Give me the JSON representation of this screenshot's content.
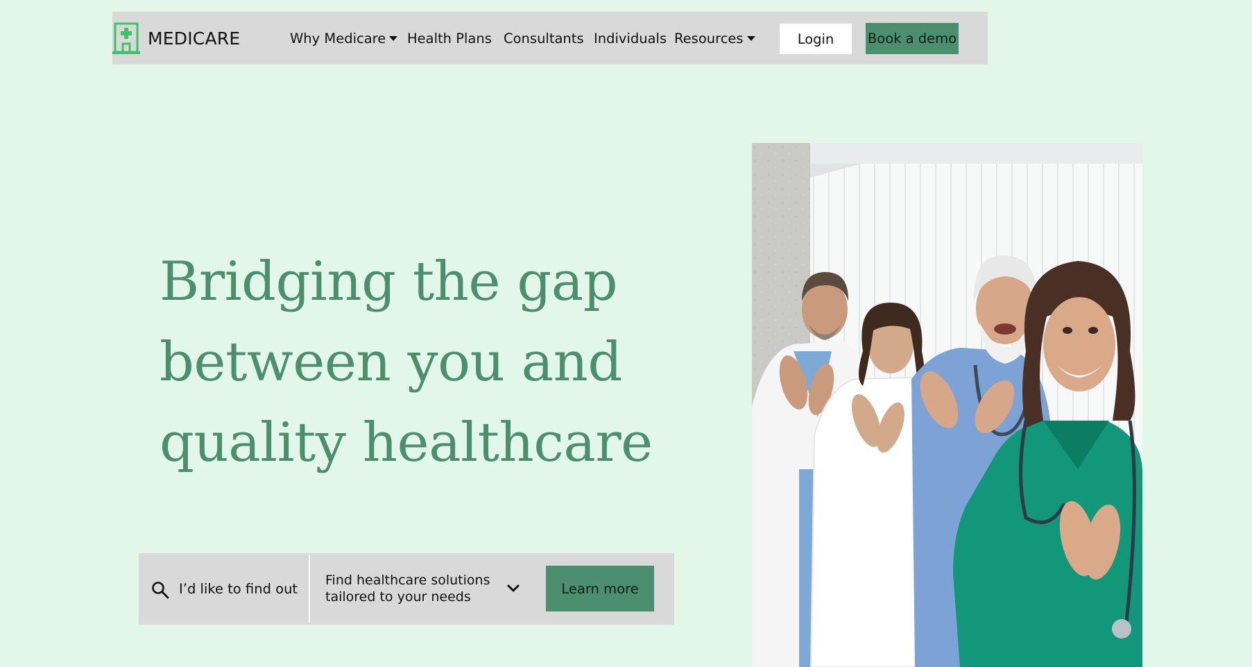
{
  "brand": {
    "name": "MEDICARE",
    "icon": "hospital-building-icon",
    "accent_color": "#4c8f6e",
    "logo_color": "#3ec36a",
    "background_color": "#e2f7ea",
    "nav_background": "#d9d9d9"
  },
  "nav": {
    "items": [
      {
        "label": "Why Medicare",
        "dropdown": true
      },
      {
        "label": "Health Plans",
        "dropdown": false
      },
      {
        "label": "Consultants",
        "dropdown": false
      },
      {
        "label": "Individuals",
        "dropdown": false
      },
      {
        "label": "Resources",
        "dropdown": true
      }
    ],
    "login_label": "Login",
    "demo_label": "Book a demo"
  },
  "hero": {
    "title_lines": [
      "Bridging the gap",
      "between you and",
      "quality healthcare"
    ],
    "image_icon": "medical-team-photo"
  },
  "search": {
    "icon": "search-icon",
    "label": "I’d like to find out",
    "selected_option": "Find healthcare solutions tailored to your needs",
    "dropdown_icon": "chevron-down-icon",
    "button_label": "Learn more"
  }
}
